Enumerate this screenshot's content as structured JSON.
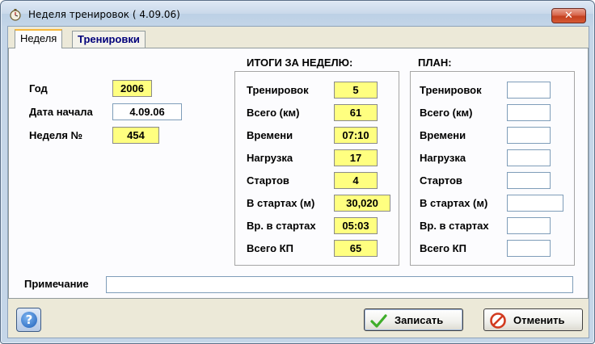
{
  "window": {
    "title": "Неделя тренировок  ( 4.09.06)",
    "close_glyph": "✕"
  },
  "tabs": [
    {
      "label": "Неделя",
      "active": true
    },
    {
      "label": "Тренировки",
      "active": false
    }
  ],
  "general": {
    "year_label": "Год",
    "year_value": "2006",
    "start_date_label": "Дата начала",
    "start_date_value": "4.09.06",
    "week_no_label": "Неделя №",
    "week_no_value": "454"
  },
  "summary": {
    "heading": "ИТОГИ ЗА НЕДЕЛЮ:",
    "rows": [
      {
        "label": "Тренировок",
        "value": "5"
      },
      {
        "label": "Всего (км)",
        "value": "61"
      },
      {
        "label": "Времени",
        "value": "07:10"
      },
      {
        "label": "Нагрузка",
        "value": "17"
      },
      {
        "label": "Стартов",
        "value": "4"
      },
      {
        "label": "В стартах (м)",
        "value": "30,020"
      },
      {
        "label": "Вр. в стартах",
        "value": "05:03"
      },
      {
        "label": "Всего КП",
        "value": "65"
      }
    ]
  },
  "plan": {
    "heading": "ПЛАН:",
    "rows": [
      {
        "label": "Тренировок",
        "value": ""
      },
      {
        "label": "Всего (км)",
        "value": ""
      },
      {
        "label": "Времени",
        "value": ""
      },
      {
        "label": "Нагрузка",
        "value": ""
      },
      {
        "label": "Стартов",
        "value": ""
      },
      {
        "label": "В стартах (м)",
        "value": ""
      },
      {
        "label": "Вр. в стартах",
        "value": ""
      },
      {
        "label": "Всего КП",
        "value": ""
      }
    ]
  },
  "note": {
    "label": "Примечание",
    "value": ""
  },
  "buttons": {
    "help_glyph": "?",
    "save_label": "Записать",
    "cancel_label": "Отменить"
  },
  "colors": {
    "readonly_field": "#ffff80",
    "save_icon": "#3fae2a",
    "cancel_icon": "#d23a1e"
  }
}
